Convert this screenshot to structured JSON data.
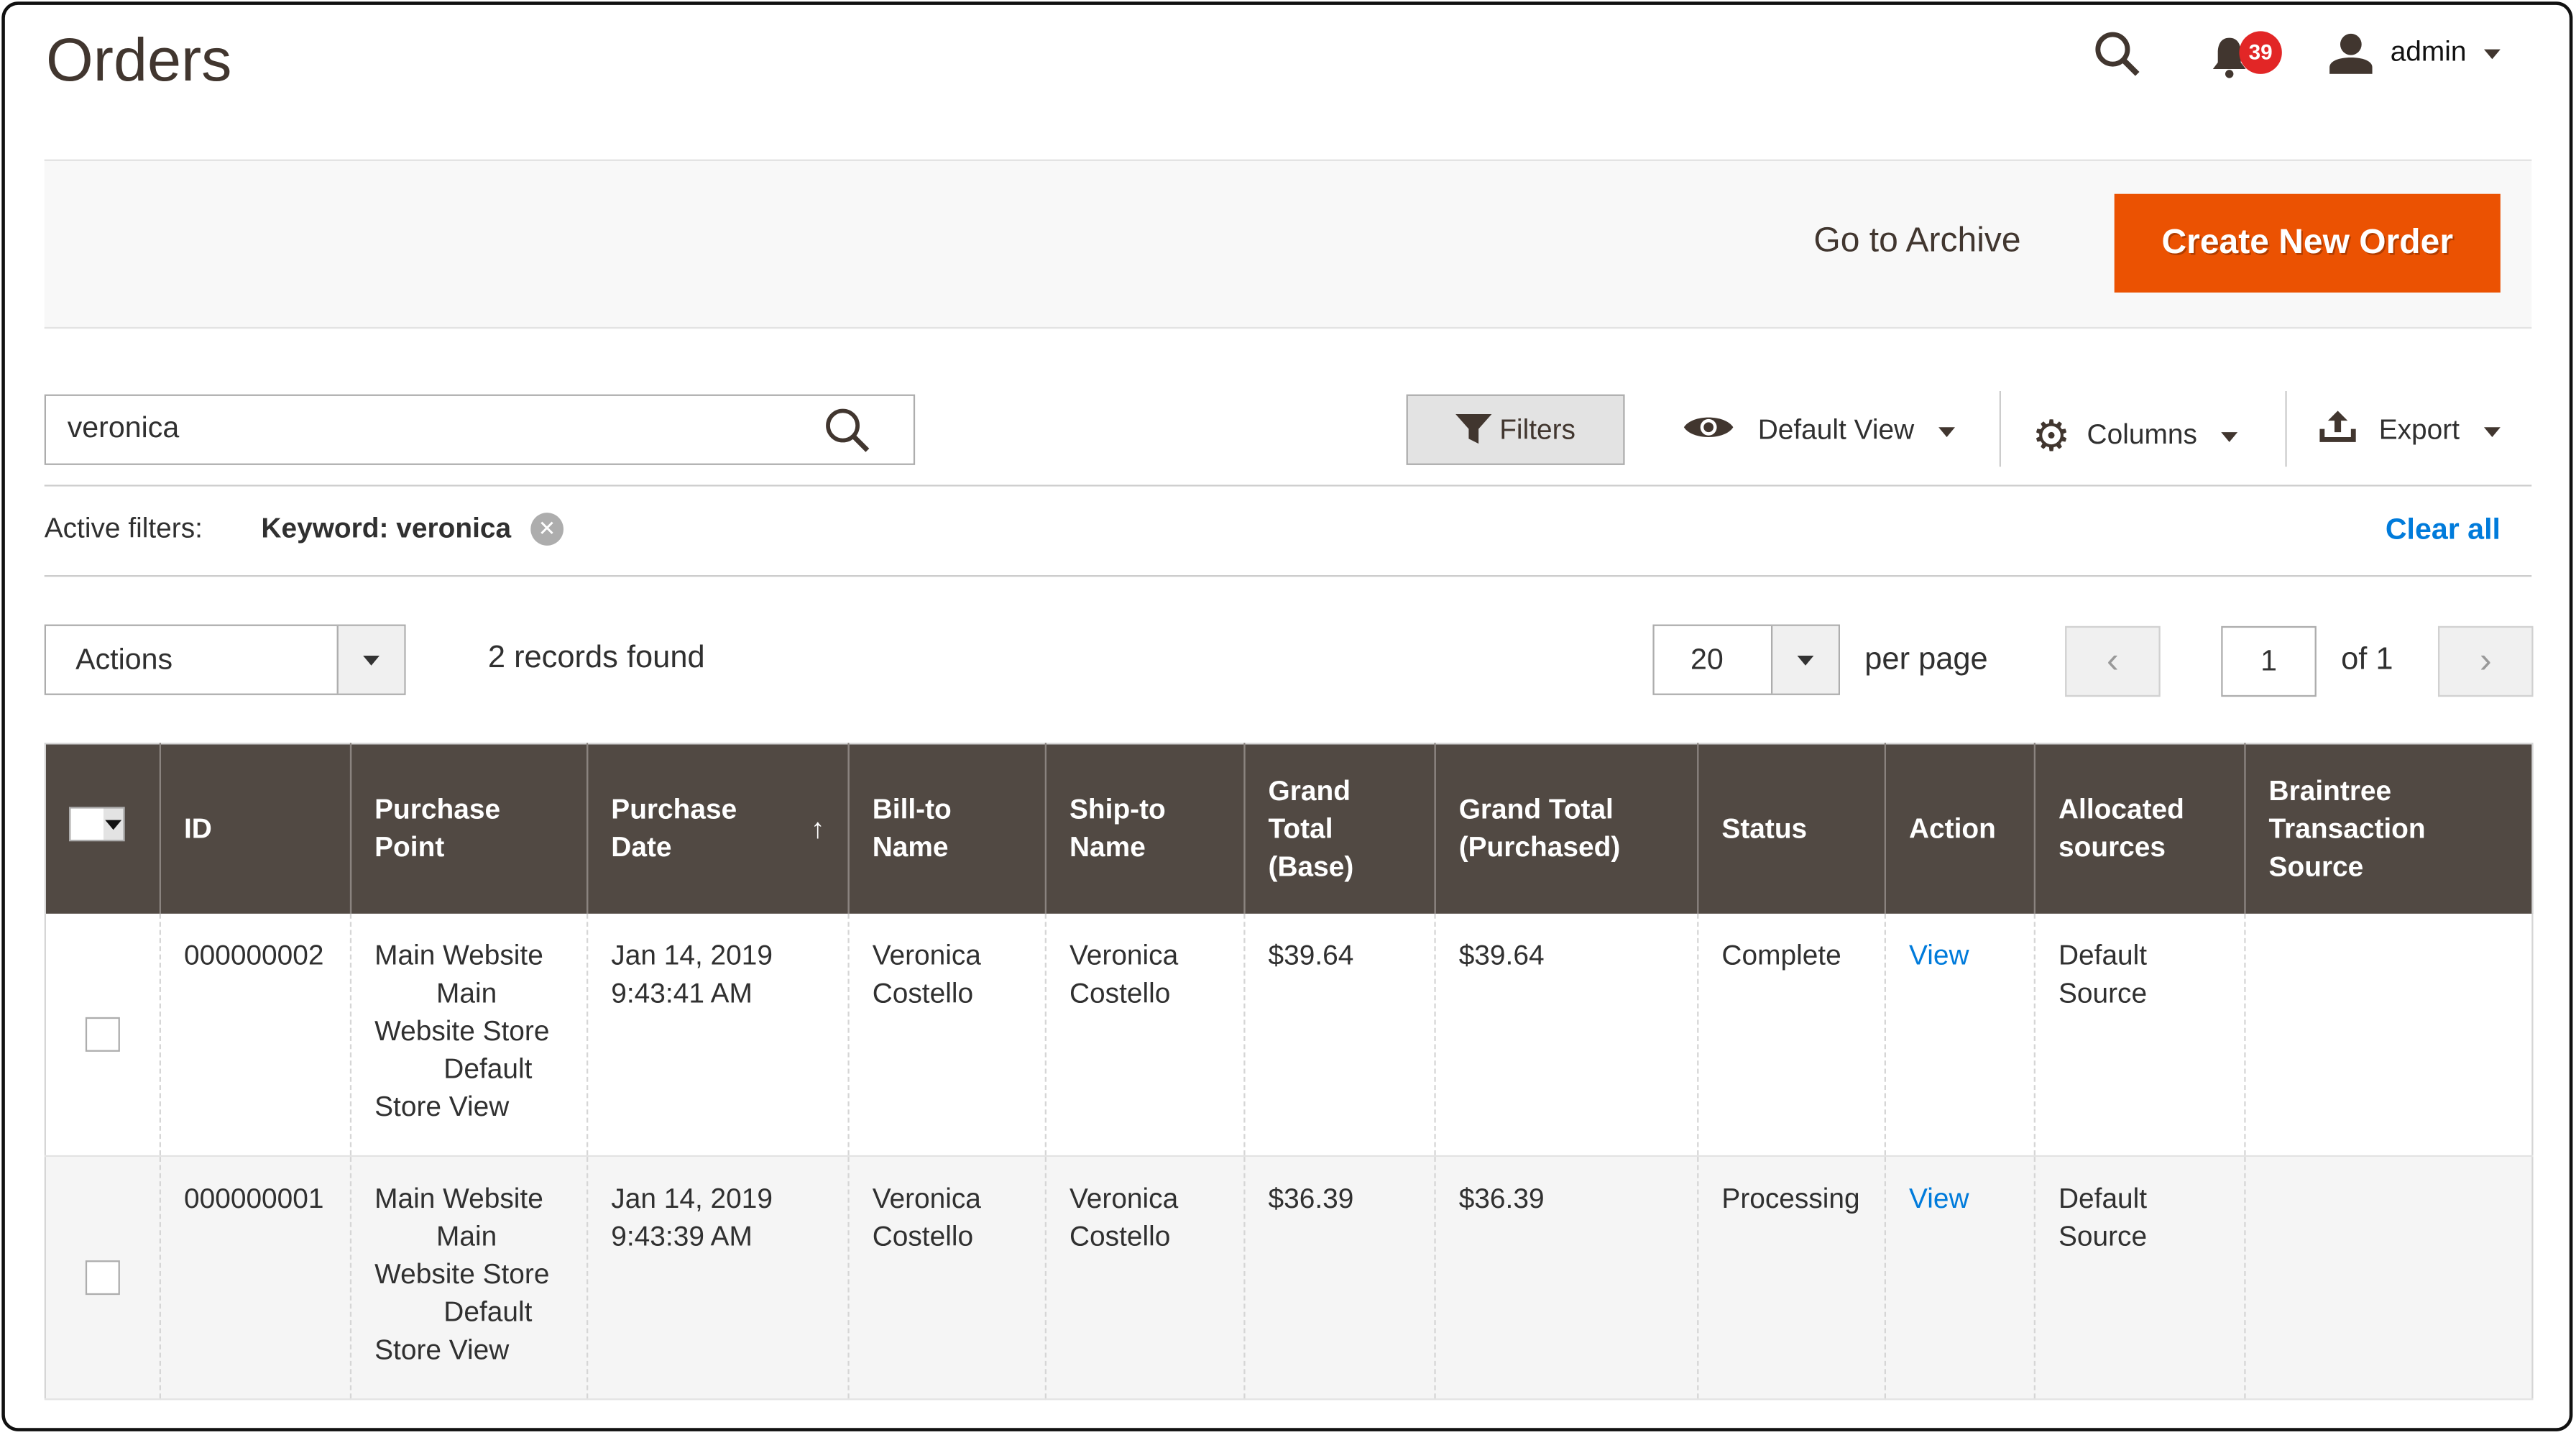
{
  "header": {
    "title": "Orders",
    "notifications_count": "39",
    "user": "admin"
  },
  "actions_bar": {
    "go_to_archive": "Go to Archive",
    "create_new_order": "Create New Order"
  },
  "toolbar": {
    "search_value": "veronica",
    "filters": "Filters",
    "view": "Default View",
    "columns": "Columns",
    "export": "Export"
  },
  "active_filters": {
    "label": "Active filters:",
    "keyword": "Keyword: veronica",
    "clear_all": "Clear all"
  },
  "grid_controls": {
    "actions": "Actions",
    "records_found": "2 records found",
    "per_page_value": "20",
    "per_page_label": "per page",
    "page": "1",
    "of_pages": "of 1"
  },
  "table": {
    "columns": [
      "ID",
      "Purchase Point",
      "Purchase Date",
      "Bill-to Name",
      "Ship-to Name",
      "Grand Total (Base)",
      "Grand Total (Purchased)",
      "Status",
      "Action",
      "Allocated sources",
      "Braintree Transaction Source"
    ],
    "sort": {
      "column": "Purchase Date",
      "direction": "ascending"
    },
    "rows": [
      {
        "id": "000000002",
        "purchase_point": [
          "Main Website",
          "Main",
          "Website Store",
          "Default",
          "Store View"
        ],
        "date": [
          "Jan 14, 2019",
          "9:43:41 AM"
        ],
        "bill_to": [
          "Veronica",
          "Costello"
        ],
        "ship_to": [
          "Veronica",
          "Costello"
        ],
        "total_base": "$39.64",
        "total_purchased": "$39.64",
        "status": "Complete",
        "action": "View",
        "sources": [
          "Default",
          "Source"
        ],
        "braintree": ""
      },
      {
        "id": "000000001",
        "purchase_point": [
          "Main Website",
          "Main",
          "Website Store",
          "Default",
          "Store View"
        ],
        "date": [
          "Jan 14, 2019",
          "9:43:39 AM"
        ],
        "bill_to": [
          "Veronica",
          "Costello"
        ],
        "ship_to": [
          "Veronica",
          "Costello"
        ],
        "total_base": "$36.39",
        "total_purchased": "$36.39",
        "status": "Processing",
        "action": "View",
        "sources": [
          "Default",
          "Source"
        ],
        "braintree": ""
      }
    ]
  },
  "colors": {
    "header_bg": "#514943",
    "primary": "#eb5202",
    "link": "#007bdb",
    "badge": "#e22626"
  }
}
